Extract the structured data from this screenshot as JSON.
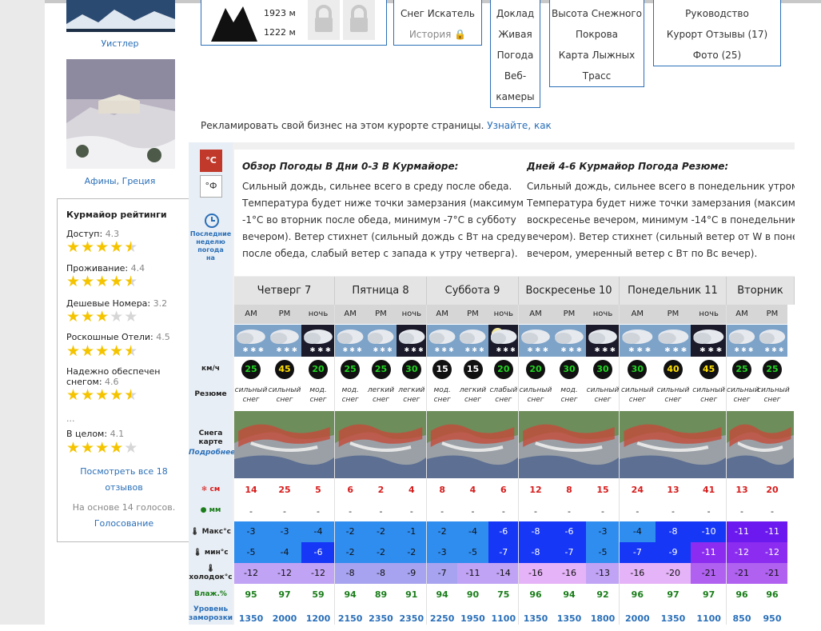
{
  "left": {
    "whistler_caption": "Уистлер",
    "athens_caption": "Афины, Греция"
  },
  "ratings": {
    "title": "Курмайор рейтинги",
    "items": [
      {
        "label": "Доступ:",
        "value": "4.3",
        "stars": 4.3
      },
      {
        "label": "Проживание:",
        "value": "4.4",
        "stars": 4.4
      },
      {
        "label": "Дешевые Номера:",
        "value": "3.2",
        "stars": 3.2
      },
      {
        "label": "Роскошные Отели:",
        "value": "4.5",
        "stars": 4.5
      },
      {
        "label": "Надежно обеспечен снегом:",
        "value": "4.6",
        "stars": 4.6
      }
    ],
    "ellipsis": "...",
    "overall_label": "В целом:",
    "overall_value": "4.1",
    "overall_stars": 4.1,
    "all_reviews_line1": "Посмотреть все 18",
    "all_reviews_line2": "отзывов",
    "based_on": "На основе 14 голосов.",
    "vote": "Голосование"
  },
  "top": {
    "elev_top": "1923 м",
    "elev_bottom": "1222 м",
    "snowfinder": "Снег Искатель",
    "history": "История",
    "box2": [
      "Доклад",
      "Живая",
      "Погода",
      "Веб-",
      "камеры"
    ],
    "box3": [
      "Высота Снежного",
      "Покрова",
      "Карта Лыжных",
      "Трасс"
    ],
    "box4": [
      "Руководство",
      "Курорт Отзывы (17)",
      "Фото (25)"
    ]
  },
  "ad": {
    "text": "Рекламировать свой бизнес на этом курорте страницы.",
    "link": "Узнайте, как"
  },
  "units": {
    "c": "°C",
    "f": "°Ф"
  },
  "sidebar": {
    "last_week": [
      "Последние",
      "неделю",
      "погода",
      "на"
    ],
    "kmh": "км/ч",
    "summary": "Резюме",
    "snowmap": [
      "Снега",
      "карте"
    ],
    "more": "Подробнее",
    "cm": "см",
    "mm": "мм",
    "max": "Макс°c",
    "min": "мин°c",
    "chill": "холодок°c",
    "humidity": "Влаж.%",
    "freeze": [
      "Уровень",
      "заморозки"
    ]
  },
  "summary": {
    "left_title": "Обзор Погоды В Дни 0-3 В Курмайоре:",
    "left_lines": [
      "Сильный дождь, сильнее всего в среду после обеда.",
      "Температура будет ниже точки замерзания (максимум",
      "-1°C во вторник после обеда, минимум -7°C в субботу",
      "вечером). Ветер стихнет (сильный дождь с Вт на среду",
      "после обеда, слабый ветер с запада к утру четверга)."
    ],
    "right_title": "Дней 4-6 Курмайор Погода Резюме:",
    "right_lines": [
      "Сильный дождь, сильнее всего в понедельник утром.",
      "Температура будет ниже точки замерзания (максимум -3",
      "воскресенье вечером, минимум -14°C в понедельник",
      "вечером). Ветер стихнет (сильный ветер от W в понедел",
      "вечером, умеренный ветер с Вт по Вс вечер)."
    ]
  },
  "days": [
    "Четверг 7",
    "Пятница 8",
    "Суббота 9",
    "Воскресенье 10",
    "Понедельник 11",
    "Вторник"
  ],
  "periods": [
    "AM",
    "PM",
    "ночь",
    "AM",
    "PM",
    "ночь",
    "AM",
    "PM",
    "ночь",
    "AM",
    "PM",
    "ночь",
    "AM",
    "PM",
    "ночь",
    "AM",
    "PM"
  ],
  "wind": [
    25,
    45,
    20,
    25,
    25,
    30,
    15,
    15,
    20,
    20,
    30,
    30,
    30,
    40,
    45,
    25,
    25
  ],
  "wind_colors": [
    "g",
    "y",
    "g",
    "g",
    "g",
    "g",
    "w",
    "w",
    "g",
    "g",
    "g",
    "g",
    "g",
    "y",
    "y",
    "g",
    "g"
  ],
  "summary_cells": [
    [
      "сильный",
      "снег"
    ],
    [
      "сильный",
      "снег"
    ],
    [
      "мод.",
      "снег"
    ],
    [
      "мод.",
      "снег"
    ],
    [
      "легкий",
      "снег"
    ],
    [
      "легкий",
      "снег"
    ],
    [
      "мод.",
      "снег"
    ],
    [
      "легкий",
      "снег"
    ],
    [
      "слабый",
      "снег"
    ],
    [
      "сильный",
      "снег"
    ],
    [
      "мод.",
      "снег"
    ],
    [
      "сильный",
      "снег"
    ],
    [
      "сильный",
      "снег"
    ],
    [
      "сильный",
      "снег"
    ],
    [
      "сильный",
      "снег"
    ],
    [
      "сильный",
      "снег"
    ],
    [
      "сильный",
      "снег"
    ]
  ],
  "snow_cm": [
    "14",
    "25",
    "5",
    "6",
    "2",
    "4",
    "8",
    "4",
    "6",
    "12",
    "8",
    "15",
    "24",
    "13",
    "41",
    "13",
    "20"
  ],
  "rain_mm": [
    "-",
    "-",
    "-",
    "-",
    "-",
    "-",
    "-",
    "-",
    "-",
    "-",
    "-",
    "-",
    "-",
    "-",
    "-",
    "-",
    "-"
  ],
  "max_c": [
    "-3",
    "-3",
    "-4",
    "-2",
    "-2",
    "-1",
    "-2",
    "-4",
    "-6",
    "-8",
    "-6",
    "-3",
    "-4",
    "-8",
    "-10",
    "-11",
    "-11"
  ],
  "min_c": [
    "-5",
    "-4",
    "-6",
    "-2",
    "-2",
    "-2",
    "-3",
    "-5",
    "-7",
    "-8",
    "-7",
    "-5",
    "-7",
    "-9",
    "-11",
    "-12",
    "-12"
  ],
  "chill_c": [
    "-12",
    "-12",
    "-12",
    "-8",
    "-8",
    "-9",
    "-7",
    "-11",
    "-14",
    "-16",
    "-16",
    "-13",
    "-16",
    "-20",
    "-21",
    "-21",
    "-21"
  ],
  "humidity": [
    "95",
    "97",
    "59",
    "94",
    "89",
    "91",
    "94",
    "90",
    "75",
    "96",
    "94",
    "92",
    "96",
    "97",
    "97",
    "96",
    "96"
  ],
  "freeze": [
    "1350",
    "2000",
    "1200",
    "2150",
    "2350",
    "2350",
    "2250",
    "1950",
    "1100",
    "1350",
    "1350",
    "1800",
    "2000",
    "1350",
    "1100",
    "850",
    "950"
  ],
  "colors": {
    "accent": "#2a6fb8",
    "unit_active": "#c0392b"
  }
}
